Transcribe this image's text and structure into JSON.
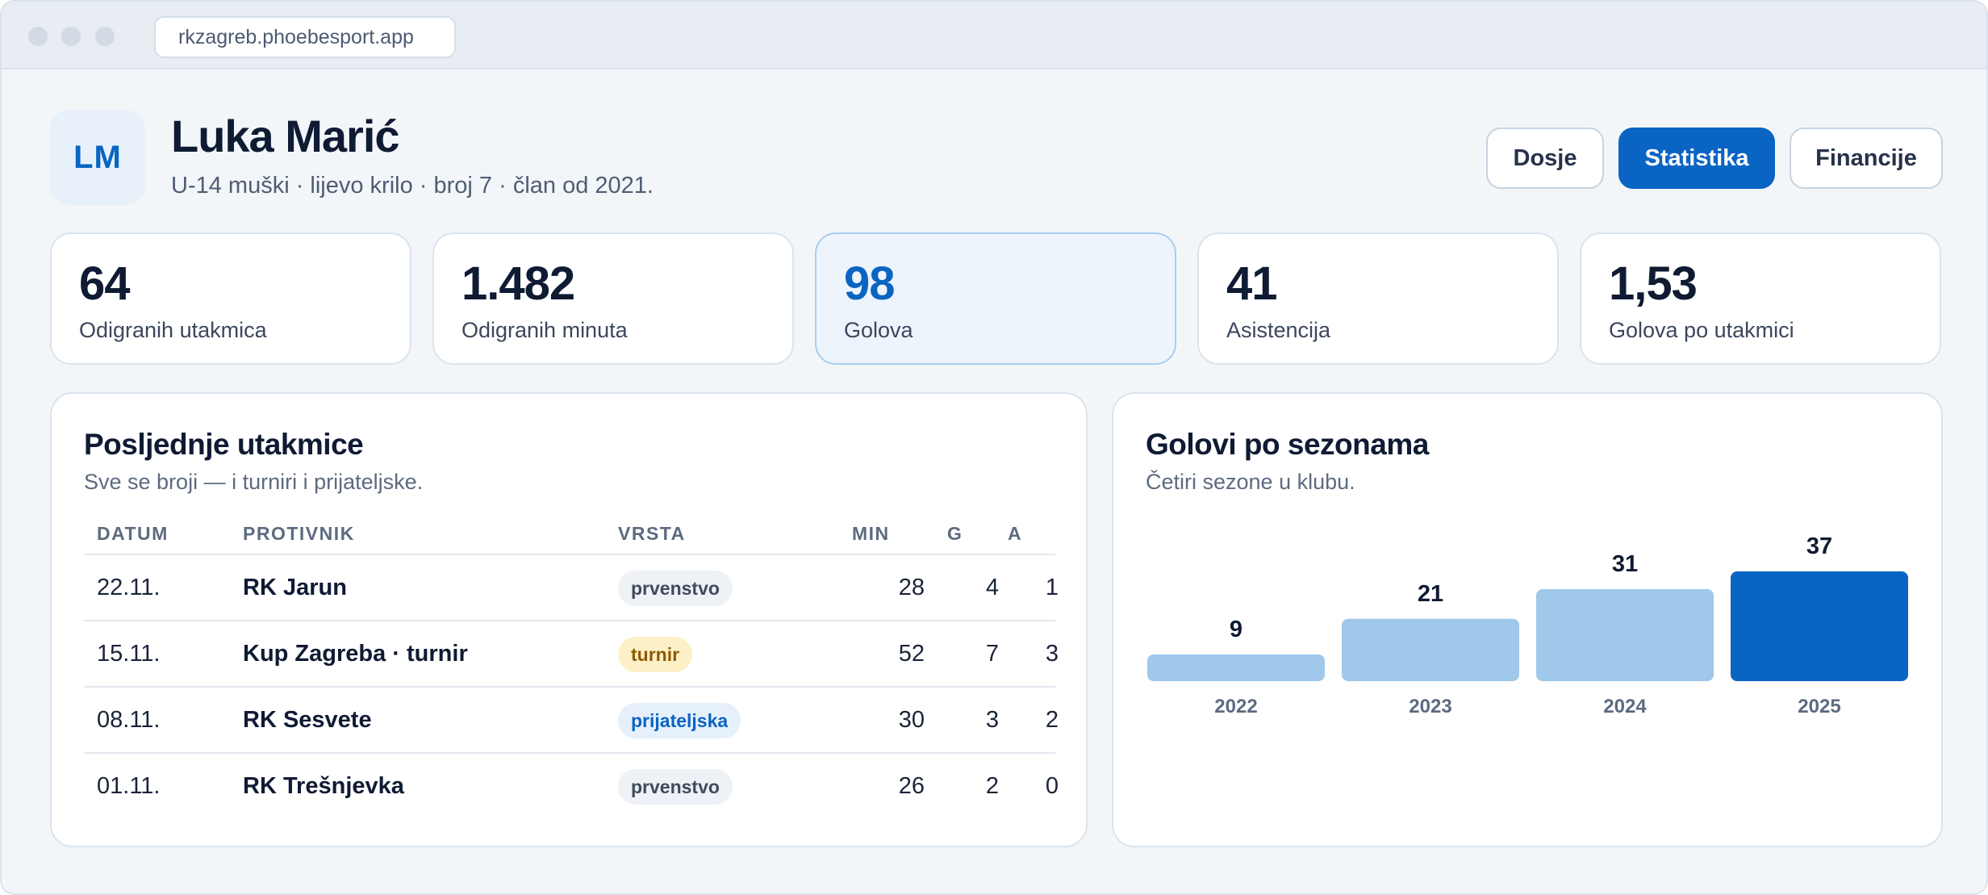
{
  "browser": {
    "url": "rkzagreb.phoebesport.app"
  },
  "player": {
    "initials": "LM",
    "name": "Luka Marić",
    "subtitle": "U-14 muški · lijevo krilo · broj 7 · član od 2021."
  },
  "nav": {
    "dosje": "Dosje",
    "statistika": "Statistika",
    "financije": "Financije",
    "active": "Statistika"
  },
  "stats": [
    {
      "value": "64",
      "label": "Odigranih utakmica"
    },
    {
      "value": "1.482",
      "label": "Odigranih minuta"
    },
    {
      "value": "98",
      "label": "Golova"
    },
    {
      "value": "41",
      "label": "Asistencija"
    },
    {
      "value": "1,53",
      "label": "Golova po utakmici"
    }
  ],
  "matches": {
    "title": "Posljednje utakmice",
    "subtitle": "Sve se broji — i turniri i prijateljske.",
    "headers": {
      "date": "DATUM",
      "opponent": "PROTIVNIK",
      "type": "VRSTA",
      "min": "MIN",
      "g": "G",
      "a": "A"
    },
    "rows": [
      {
        "date": "22.11.",
        "opponent": "RK Jarun",
        "type": "prvenstvo",
        "min": "28",
        "g": "4",
        "a": "1"
      },
      {
        "date": "15.11.",
        "opponent": "Kup Zagreba · turnir",
        "type": "turnir",
        "min": "52",
        "g": "7",
        "a": "3"
      },
      {
        "date": "08.11.",
        "opponent": "RK Sesvete",
        "type": "prijateljska",
        "min": "30",
        "g": "3",
        "a": "2"
      },
      {
        "date": "01.11.",
        "opponent": "RK Trešnjevka",
        "type": "prvenstvo",
        "min": "26",
        "g": "2",
        "a": "0"
      }
    ]
  },
  "goals_chart": {
    "title": "Golovi po sezonama",
    "subtitle": "Četiri sezone u klubu."
  },
  "chart_data": {
    "type": "bar",
    "categories": [
      "2022",
      "2023",
      "2024",
      "2025"
    ],
    "values": [
      9,
      21,
      31,
      37
    ],
    "highlight": "2025",
    "colors": {
      "bar": "#9fc8ea",
      "highlight": "#0a64c4"
    }
  }
}
